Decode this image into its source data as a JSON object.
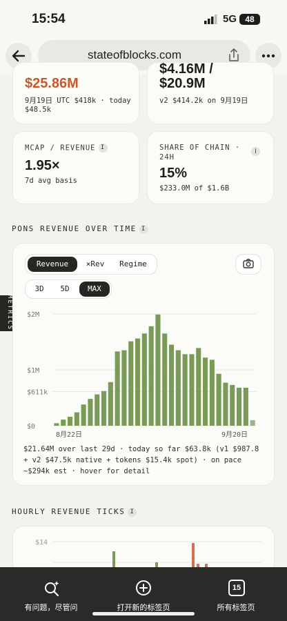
{
  "status_bar": {
    "time": "15:54",
    "network": "5G",
    "battery": "48"
  },
  "browser": {
    "url": "stateofblocks.com"
  },
  "stats": {
    "revenue": {
      "value": "$25.86M",
      "line1": "9月19日 UTC $418k · today",
      "line2": "$48.5k"
    },
    "revenue_v2": {
      "value_top": "$4.16M /",
      "value": "$20.9M",
      "line1": "v2 $414.2k on 9月19日"
    },
    "mcap": {
      "label": "MCAP / REVENUE",
      "value": "1.95×",
      "note": "7d avg basis"
    },
    "share": {
      "label_line1": "SHARE OF CHAIN ·",
      "label_line2": "24H",
      "value": "15%",
      "note": "$233.0M of $1.6B"
    }
  },
  "sections": {
    "revenue_over_time": "PONS REVENUE OVER TIME",
    "hourly": "HOURLY REVENUE TICKS"
  },
  "info_glyph": "I",
  "metrics_tab": "METRICS",
  "chart_controls": {
    "modes": [
      "Revenue",
      "×Rev",
      "Regime"
    ],
    "active_mode": "Revenue",
    "ranges": [
      "3D",
      "5D",
      "MAX"
    ],
    "active_range": "MAX"
  },
  "chart_data": {
    "type": "bar",
    "y_ticks": [
      "$2M",
      "$1M",
      "$611k",
      "$0"
    ],
    "y_tick_values": [
      2000000,
      1000000,
      611000,
      0
    ],
    "ylim": [
      0,
      2000000
    ],
    "x_tick_labels": [
      "8月22日",
      "9月20日"
    ],
    "series": [
      {
        "values": [
          45000,
          110000,
          160000,
          240000,
          380000,
          480000,
          560000,
          620000,
          780000,
          1330000,
          1350000,
          1510000,
          1560000,
          1650000,
          1780000,
          1990000,
          1650000,
          1450000,
          1350000,
          1280000,
          1280000,
          1390000,
          1220000,
          1180000,
          930000,
          770000,
          730000,
          680000,
          680000,
          100000
        ],
        "color": "#7a9a58"
      }
    ]
  },
  "chart_summary": "$21.64M over last 29d · today so far $63.8k (v1 $987.8 + v2 $47.5k native + tokens $15.4k spot) · on pace ~$294k est · hover for detail",
  "hourly_chart": {
    "y_tick": "$14"
  },
  "bottom_bar": {
    "ask": "有问题，尽管问",
    "new_tab": "打开新的标签页",
    "all_tabs": "所有标签页",
    "tab_count": "15"
  }
}
